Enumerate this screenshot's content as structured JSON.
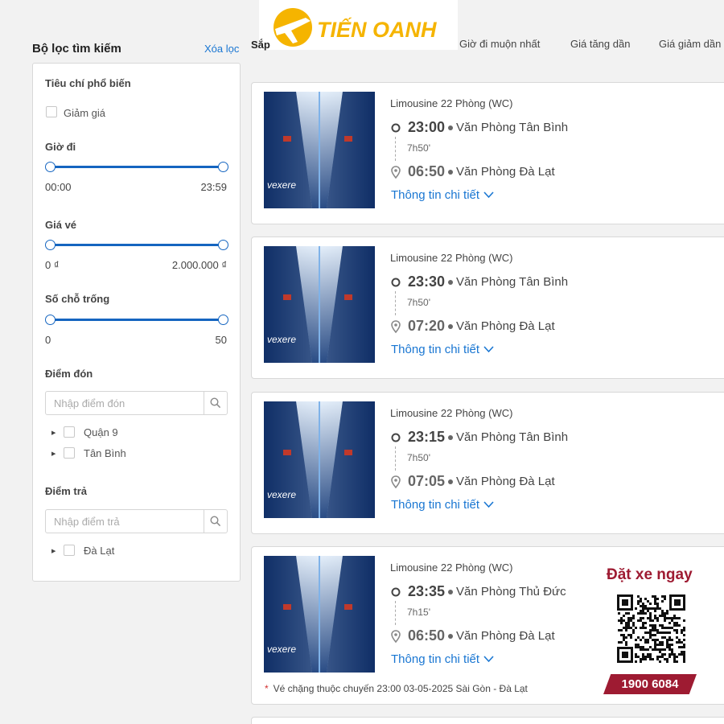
{
  "brand": {
    "name": "TIẾN OANH",
    "colors": {
      "accent": "#1976d2",
      "slider": "#1565c0",
      "brand_red": "#9e1b32",
      "logo_yellow": "#f5b400"
    }
  },
  "filter": {
    "title": "Bộ lọc tìm kiếm",
    "clear": "Xóa lọc",
    "popular": {
      "title": "Tiêu chí phổ biến",
      "discount_label": "Giảm giá",
      "discount_checked": false
    },
    "departure_time": {
      "title": "Giờ đi",
      "min": "00:00",
      "max": "23:59",
      "low_fraction": 0,
      "high_fraction": 1
    },
    "price": {
      "title": "Giá vé",
      "min": "0 ₫",
      "max": "2.000.000 ₫",
      "low_fraction": 0,
      "high_fraction": 1
    },
    "seats": {
      "title": "Số chỗ trống",
      "min": "0",
      "max": "50",
      "low_fraction": 0,
      "high_fraction": 1
    },
    "pickup": {
      "title": "Điểm đón",
      "placeholder": "Nhập điểm đón",
      "items": [
        {
          "label": "Quận 9"
        },
        {
          "label": "Tân Bình"
        }
      ]
    },
    "dropoff": {
      "title": "Điểm trả",
      "placeholder": "Nhập điểm trả",
      "items": [
        {
          "label": "Đà Lạt"
        }
      ]
    }
  },
  "sort": {
    "label_partial": "Sắp",
    "options": [
      "Giờ đi muộn nhất",
      "Giá tăng dần",
      "Giá giảm dần"
    ]
  },
  "trips": [
    {
      "vehicle": "Limousine 22 Phòng (WC)",
      "depart_time": "23:00",
      "depart_place": "Văn Phòng Tân Bình",
      "duration": "7h50'",
      "arrive_time": "06:50",
      "arrive_place": "Văn Phòng Đà Lạt",
      "detail_link": "Thông tin chi tiết",
      "thumb_watermark": "vexere"
    },
    {
      "vehicle": "Limousine 22 Phòng (WC)",
      "depart_time": "23:30",
      "depart_place": "Văn Phòng Tân Bình",
      "duration": "7h50'",
      "arrive_time": "07:20",
      "arrive_place": "Văn Phòng Đà Lạt",
      "detail_link": "Thông tin chi tiết",
      "thumb_watermark": "vexere"
    },
    {
      "vehicle": "Limousine 22 Phòng (WC)",
      "depart_time": "23:15",
      "depart_place": "Văn Phòng Tân Bình",
      "duration": "7h50'",
      "arrive_time": "07:05",
      "arrive_place": "Văn Phòng Đà Lạt",
      "detail_link": "Thông tin chi tiết",
      "thumb_watermark": "vexere"
    },
    {
      "vehicle": "Limousine 22 Phòng (WC)",
      "depart_time": "23:35",
      "depart_place": "Văn Phòng Thủ Đức",
      "duration": "7h15'",
      "arrive_time": "06:50",
      "arrive_place": "Văn Phòng Đà Lạt",
      "detail_link": "Thông tin chi tiết",
      "thumb_watermark": "vexere",
      "note": "Vé chặng thuộc chuyến 23:00 03-05-2025 Sài Gòn - Đà Lạt"
    }
  ],
  "promo": {
    "title": "Đặt xe ngay",
    "hotline": "1900 6084"
  }
}
